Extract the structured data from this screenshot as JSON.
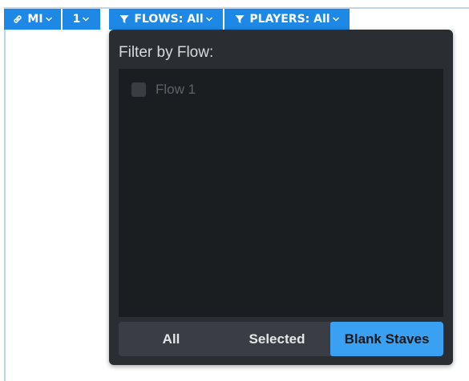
{
  "toolbar": {
    "link_button": {
      "label": "MI",
      "icon": "link-icon"
    },
    "page_button": {
      "label": "1"
    },
    "flows_button": {
      "label": "FLOWS: All",
      "icon": "filter-icon"
    },
    "players_button": {
      "label": "PLAYERS: All",
      "icon": "filter-icon"
    }
  },
  "flow_filter": {
    "title": "Filter by Flow:",
    "items": [
      {
        "label": "Flow 1",
        "checked": false
      }
    ],
    "selection_buttons": {
      "all": "All",
      "selected": "Selected",
      "blank_staves": "Blank Staves"
    },
    "active_selection": "blank_staves"
  },
  "colors": {
    "toolbar_blue": "#1d88e5",
    "popup_bg": "#2a2d31",
    "list_bg": "#1b1e21",
    "active_blue": "#3aa0f2",
    "frame": "#bcd6ef"
  }
}
